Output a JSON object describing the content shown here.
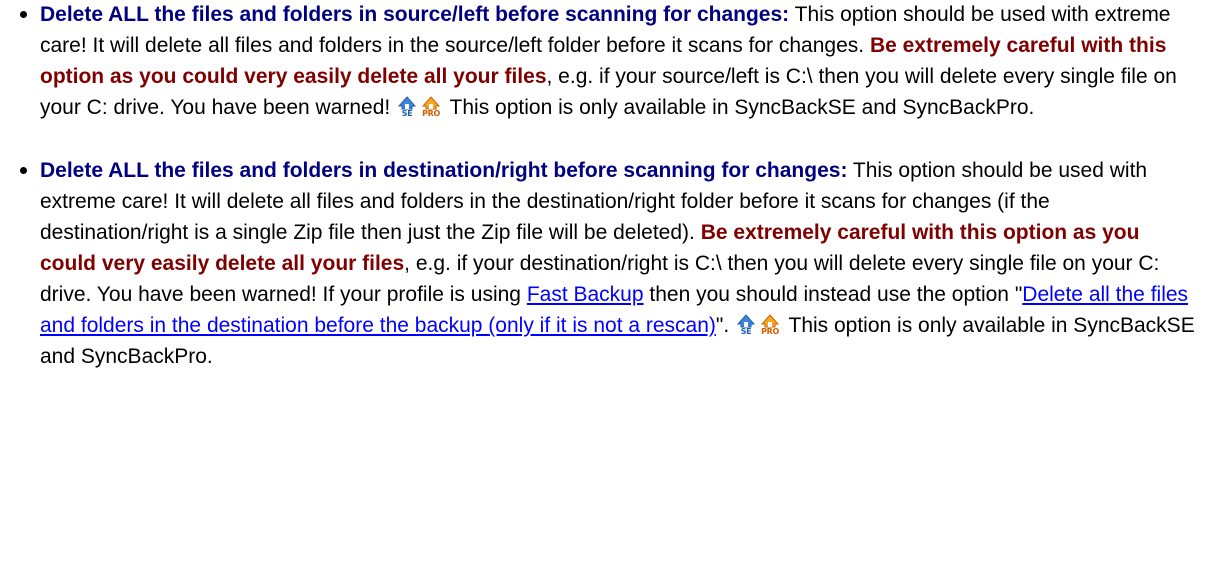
{
  "items": [
    {
      "heading": "Delete ALL the files and folders in source/left before scanning for changes:",
      "text1": " This option should be used with extreme care! It will delete all files and folders in the source/left folder before it scans for changes. ",
      "warning": "Be extremely careful with this option as you could very easily delete all your files",
      "text2": ", e.g. if your source/left is C:\\ then you will delete every single file on your C: drive. You have been warned! ",
      "availability": " This option is only available in SyncBackSE and SyncBackPro."
    },
    {
      "heading": "Delete ALL the files and folders in destination/right before scanning for changes:",
      "text1": " This option should be used with extreme care! It will delete all files and folders in the destination/right folder before it scans for changes (if the destination/right is a single Zip file then just the Zip file will be deleted). ",
      "warning": "Be extremely careful with this option as you could very easily delete all your files",
      "text2": ", e.g. if your destination/right is C:\\ then you will delete every single file on your C: drive. You have been warned! If your profile is using ",
      "link1": "Fast Backup",
      "text3": " then you should instead use the option \"",
      "link2": "Delete all the files and folders in the destination before the backup (only if it is not a rescan)",
      "text4": "\". ",
      "availability": " This option is only available in SyncBackSE and SyncBackPro."
    }
  ],
  "badges": {
    "se": {
      "text": "SE",
      "icon": "syncback-se-icon",
      "color": "#1f5fb5"
    },
    "pro": {
      "text": "PRO",
      "icon": "syncback-pro-icon",
      "color": "#d06000"
    }
  }
}
